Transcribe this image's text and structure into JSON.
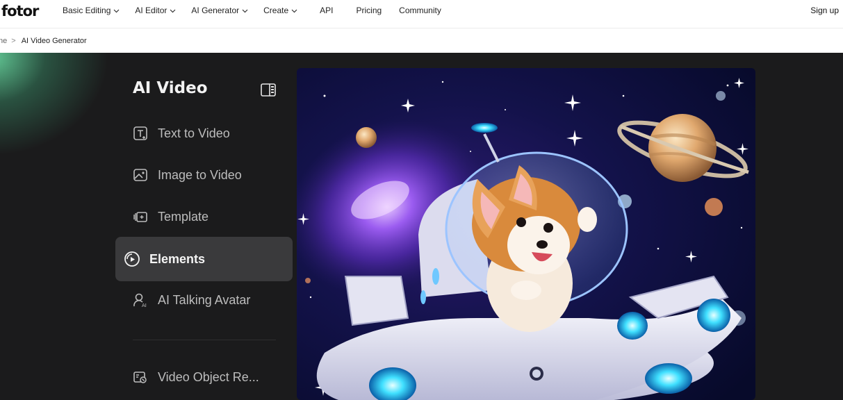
{
  "brand": {
    "logo_text": "fotor"
  },
  "nav": {
    "items": [
      {
        "label": "Basic Editing",
        "has_dropdown": true
      },
      {
        "label": "AI Editor",
        "has_dropdown": true
      },
      {
        "label": "AI Generator",
        "has_dropdown": true
      },
      {
        "label": "Create",
        "has_dropdown": true
      },
      {
        "label": "API",
        "has_dropdown": false
      },
      {
        "label": "Pricing",
        "has_dropdown": false
      },
      {
        "label": "Community",
        "has_dropdown": false
      }
    ],
    "signup_label": "Sign up"
  },
  "breadcrumb": {
    "home_partial": "ne",
    "separator": ">",
    "current": "AI Video Generator"
  },
  "sidebar": {
    "title": "AI Video",
    "items": [
      {
        "label": "Text to Video",
        "icon": "text-to-video-icon",
        "active": false
      },
      {
        "label": "Image to Video",
        "icon": "image-to-video-icon",
        "active": false
      },
      {
        "label": "Template",
        "icon": "template-icon",
        "active": false
      },
      {
        "label": "Elements",
        "icon": "elements-icon",
        "active": true
      },
      {
        "label": "AI Talking Avatar",
        "icon": "talking-avatar-icon",
        "active": false
      },
      {
        "label": "Video Object Re...",
        "icon": "video-object-remover-icon",
        "active": false
      }
    ]
  },
  "hero": {
    "description_icon": "corgi-astronaut-spaceship-image"
  },
  "colors": {
    "background": "#1b1b1c",
    "active_item": "#3a3a3c",
    "glow": "#6ee6aa",
    "text_muted": "#bdbdbd"
  }
}
